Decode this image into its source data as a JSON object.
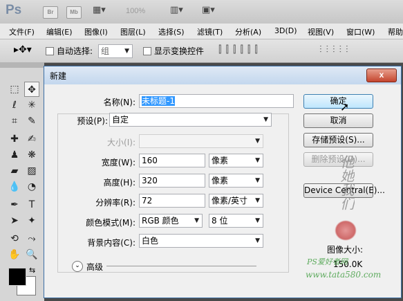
{
  "app": {
    "logo": "Ps",
    "bridge_icon": "Br",
    "minibridge_icon": "Mb",
    "zoom": "100%"
  },
  "menu": [
    "文件(F)",
    "编辑(E)",
    "图像(I)",
    "图层(L)",
    "选择(S)",
    "滤镜(T)",
    "分析(A)",
    "3D(D)",
    "视图(V)",
    "窗口(W)",
    "帮助"
  ],
  "options": {
    "auto_select_label": "自动选择:",
    "auto_select_value": "组",
    "show_transform_label": "显示变换控件"
  },
  "dialog": {
    "title": "新建",
    "name_label": "名称(N):",
    "name_value": "未标题-1",
    "preset_label": "预设(P):",
    "preset_value": "自定",
    "size_label": "大小(I):",
    "width_label": "宽度(W):",
    "width_value": "160",
    "width_unit": "像素",
    "height_label": "高度(H):",
    "height_value": "320",
    "height_unit": "像素",
    "resolution_label": "分辨率(R):",
    "resolution_value": "72",
    "resolution_unit": "像素/英寸",
    "color_mode_label": "颜色模式(M):",
    "color_mode_value": "RGB 颜色",
    "bit_depth_value": "8 位",
    "background_label": "背景内容(C):",
    "background_value": "白色",
    "advanced_label": "高级",
    "ok_button": "确定",
    "cancel_button": "取消",
    "save_preset_button": "存储预设(S)...",
    "delete_preset_button": "删除预设(D)...",
    "device_central_button": "Device Central(E)...",
    "image_size_label": "图像大小:",
    "image_size_value": "150.0K",
    "close_symbol": "x"
  },
  "watermark": {
    "vertical_text": "他她我们",
    "site_line1": "PS爱好者网",
    "site_line2": "www.tata580.com"
  }
}
